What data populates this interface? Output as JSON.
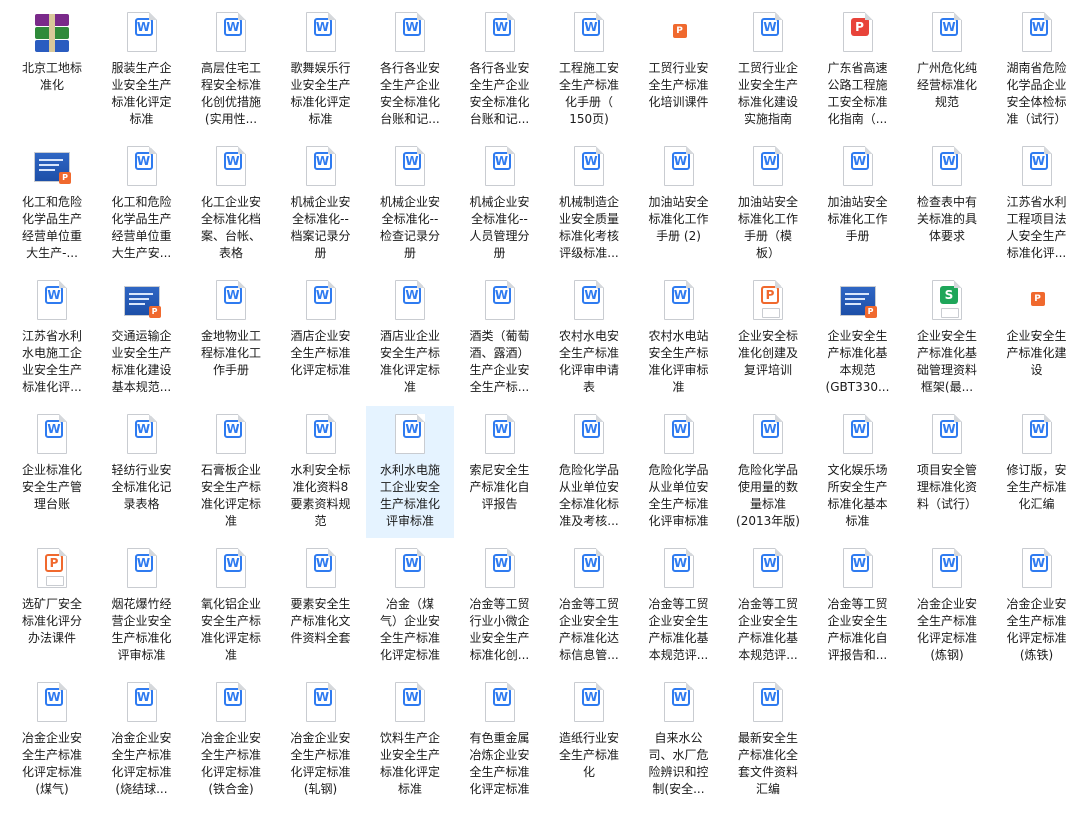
{
  "colors": {
    "word": "#2f7bf0",
    "ppt": "#f0692e",
    "xls": "#1fa65a",
    "pdf": "#e8433a",
    "selection": "#e5f3ff"
  },
  "files": [
    {
      "name": "北京工地标\n准化",
      "icon": "archive-icon"
    },
    {
      "name": "服装生产企\n业安全生产\n标准化评定\n标准",
      "icon": "word-doc-icon"
    },
    {
      "name": "高层住宅工\n程安全标准\n化创优措施\n(实用性...",
      "icon": "word-doc-icon"
    },
    {
      "name": "歌舞娱乐行\n业安全生产\n标准化评定\n标准",
      "icon": "word-doc-icon"
    },
    {
      "name": "各行各业安\n全生产企业\n安全标准化\n台账和记...",
      "icon": "word-doc-icon"
    },
    {
      "name": "各行各业安\n全生产企业\n安全标准化\n台账和记...",
      "icon": "word-doc-icon"
    },
    {
      "name": "工程施工安\n全生产标准\n化手册（\n150页)",
      "icon": "word-doc-icon"
    },
    {
      "name": "工贸行业安\n全生产标准\n化培训课件",
      "icon": "ppt-icon"
    },
    {
      "name": "工贸行业企\n业安全生产\n标准化建设\n实施指南",
      "icon": "word-doc-icon"
    },
    {
      "name": "广东省高速\n公路工程施\n工安全标准\n化指南（...",
      "icon": "pdf-doc-icon"
    },
    {
      "name": "广州危化纯\n经营标准化\n规范",
      "icon": "word-doc-icon"
    },
    {
      "name": "湖南省危险\n化学品企业\n安全体检标\n准（试行）",
      "icon": "word-doc-icon"
    },
    {
      "name": "化工和危险\n化学品生产\n经营单位重\n大生产-...",
      "icon": "ppt-thumbnail-icon"
    },
    {
      "name": "化工和危险\n化学品生产\n经营单位重\n大生产安...",
      "icon": "word-doc-icon"
    },
    {
      "name": "化工企业安\n全标准化档\n案、台帐、\n表格",
      "icon": "word-doc-icon"
    },
    {
      "name": "机械企业安\n全标准化--\n档案记录分\n册",
      "icon": "word-doc-icon"
    },
    {
      "name": "机械企业安\n全标准化--\n检查记录分\n册",
      "icon": "word-doc-icon"
    },
    {
      "name": "机械企业安\n全标准化--\n人员管理分\n册",
      "icon": "word-doc-icon"
    },
    {
      "name": "机械制造企\n业安全质量\n标准化考核\n评级标准...",
      "icon": "word-doc-icon"
    },
    {
      "name": "加油站安全\n标准化工作\n手册 (2)",
      "icon": "word-doc-icon"
    },
    {
      "name": "加油站安全\n标准化工作\n手册（模\n板）",
      "icon": "word-doc-icon"
    },
    {
      "name": "加油站安全\n标准化工作\n手册",
      "icon": "word-doc-icon"
    },
    {
      "name": "检查表中有\n关标准的具\n体要求",
      "icon": "word-doc-icon"
    },
    {
      "name": "江苏省水利\n工程项目法\n人安全生产\n标准化评...",
      "icon": "word-doc-icon"
    },
    {
      "name": "江苏省水利\n水电施工企\n业安全生产\n标准化评...",
      "icon": "word-doc-icon"
    },
    {
      "name": "交通运输企\n业安全生产\n标准化建设\n基本规范...",
      "icon": "ppt-thumbnail-icon"
    },
    {
      "name": "金地物业工\n程标准化工\n作手册",
      "icon": "word-doc-icon"
    },
    {
      "name": "酒店企业安\n全生产标准\n化评定标准",
      "icon": "word-doc-icon"
    },
    {
      "name": "酒店业企业\n安全生产标\n准化评定标\n准",
      "icon": "word-doc-icon"
    },
    {
      "name": "酒类（葡萄\n酒、露酒）\n生产企业安\n全生产标...",
      "icon": "word-doc-icon"
    },
    {
      "name": "农村水电安\n全生产标准\n化评审申请\n表",
      "icon": "word-doc-icon"
    },
    {
      "name": "农村水电站\n安全生产标\n准化评审标\n准",
      "icon": "word-doc-icon"
    },
    {
      "name": "企业安全标\n准化创建及\n复评培训",
      "icon": "ppt-doc-icon"
    },
    {
      "name": "企业安全生\n产标准化基\n本规范\n(GBT330...",
      "icon": "ppt-thumbnail-icon"
    },
    {
      "name": "企业安全生\n产标准化基\n础管理资料\n框架(最...",
      "icon": "spreadsheet-icon"
    },
    {
      "name": "企业安全生\n产标准化建\n设",
      "icon": "ppt-icon"
    },
    {
      "name": "企业标准化\n安全生产管\n理台账",
      "icon": "word-doc-icon"
    },
    {
      "name": "轻纺行业安\n全标准化记\n录表格",
      "icon": "word-doc-icon"
    },
    {
      "name": "石膏板企业\n安全生产标\n准化评定标\n准",
      "icon": "word-doc-icon"
    },
    {
      "name": "水利安全标\n准化资料8\n要素资料规\n范",
      "icon": "word-doc-icon"
    },
    {
      "name": "水利水电施\n工企业安全\n生产标准化\n评审标准",
      "icon": "word-doc-icon",
      "selected": true
    },
    {
      "name": "索尼安全生\n产标准化自\n评报告",
      "icon": "word-doc-icon"
    },
    {
      "name": "危险化学品\n从业单位安\n全标准化标\n准及考核...",
      "icon": "word-doc-icon"
    },
    {
      "name": "危险化学品\n从业单位安\n全生产标准\n化评审标准",
      "icon": "word-doc-icon"
    },
    {
      "name": "危险化学品\n使用量的数\n量标准\n(2013年版)",
      "icon": "word-doc-icon"
    },
    {
      "name": "文化娱乐场\n所安全生产\n标准化基本\n标准",
      "icon": "word-doc-icon"
    },
    {
      "name": "项目安全管\n理标准化资\n料（试行）",
      "icon": "word-doc-icon"
    },
    {
      "name": "修订版，安\n全生产标准\n化汇编",
      "icon": "word-doc-icon"
    },
    {
      "name": "选矿厂安全\n标准化评分\n办法课件",
      "icon": "ppt-doc-icon"
    },
    {
      "name": "烟花爆竹经\n营企业安全\n生产标准化\n评审标准",
      "icon": "word-doc-icon"
    },
    {
      "name": "氧化铝企业\n安全生产标\n准化评定标\n准",
      "icon": "word-doc-icon"
    },
    {
      "name": "要素安全生\n产标准化文\n件资料全套",
      "icon": "word-doc-icon"
    },
    {
      "name": "冶金（煤\n气）企业安\n全生产标准\n化评定标准",
      "icon": "word-doc-icon"
    },
    {
      "name": "冶金等工贸\n行业小微企\n业安全生产\n标准化创...",
      "icon": "word-doc-icon"
    },
    {
      "name": "冶金等工贸\n企业安全生\n产标准化达\n标信息管...",
      "icon": "word-doc-icon"
    },
    {
      "name": "冶金等工贸\n企业安全生\n产标准化基\n本规范评...",
      "icon": "word-doc-icon"
    },
    {
      "name": "冶金等工贸\n企业安全生\n产标准化基\n本规范评...",
      "icon": "word-doc-icon"
    },
    {
      "name": "冶金等工贸\n企业安全生\n产标准化自\n评报告和...",
      "icon": "word-doc-icon"
    },
    {
      "name": "冶金企业安\n全生产标准\n化评定标准\n(炼钢)",
      "icon": "word-doc-icon"
    },
    {
      "name": "冶金企业安\n全生产标准\n化评定标准\n(炼铁)",
      "icon": "word-doc-icon"
    },
    {
      "name": "冶金企业安\n全生产标准\n化评定标准\n(煤气)",
      "icon": "word-doc-icon"
    },
    {
      "name": "冶金企业安\n全生产标准\n化评定标准\n(烧结球...",
      "icon": "word-doc-icon"
    },
    {
      "name": "冶金企业安\n全生产标准\n化评定标准\n(铁合金)",
      "icon": "word-doc-icon"
    },
    {
      "name": "冶金企业安\n全生产标准\n化评定标准\n(轧钢)",
      "icon": "word-doc-icon"
    },
    {
      "name": "饮料生产企\n业安全生产\n标准化评定\n标准",
      "icon": "word-doc-icon"
    },
    {
      "name": "有色重金属\n冶炼企业安\n全生产标准\n化评定标准",
      "icon": "word-doc-icon"
    },
    {
      "name": "造纸行业安\n全生产标准\n化",
      "icon": "word-doc-icon"
    },
    {
      "name": "自来水公\n司、水厂危\n险辨识和控\n制(安全...",
      "icon": "word-doc-icon"
    },
    {
      "name": "最新安全生\n产标准化全\n套文件资料\n汇编",
      "icon": "word-doc-icon"
    }
  ]
}
